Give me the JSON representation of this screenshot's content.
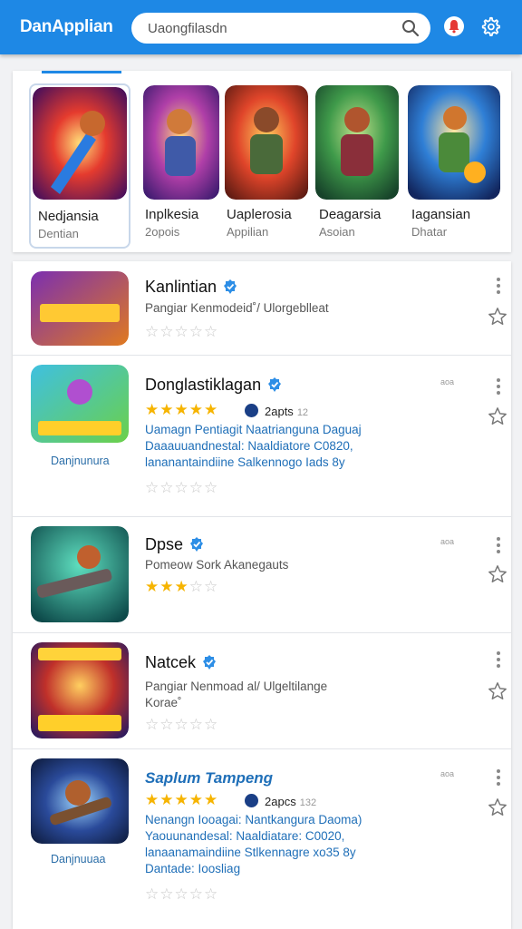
{
  "header": {
    "app_title": "DanApplian",
    "search_placeholder": "Uaongfilasdn",
    "icons": [
      "search-icon",
      "bell-icon",
      "gear-icon"
    ],
    "brand_color": "#1e88e5"
  },
  "featured": [
    {
      "name": "Nedjansia",
      "sub": "Dentian",
      "selected": true
    },
    {
      "name": "Inplkesia",
      "sub": "2opois",
      "selected": false
    },
    {
      "name": "Uaplerosia",
      "sub": "Appilian",
      "selected": false
    },
    {
      "name": "Deagarsia",
      "sub": "Asoian",
      "selected": false
    },
    {
      "name": "Iagansian",
      "sub": "Dhatar",
      "selected": false
    }
  ],
  "list": [
    {
      "title": "Kanlintian",
      "desc": "Pangiar Kenmodeid˚/ Ulorgeblleat",
      "rating": 0
    },
    {
      "title": "Donglastiklagan",
      "rating": 5,
      "badge": "2apts",
      "badge_extra": "12",
      "meta": "aoa",
      "desc_lines": [
        "Uamagn Pentiagit  Naatrianguna Daguaj",
        "Daaauuandnestal:  Naaldiatore C0820,",
        "lananantaindiine  Salkennogo Iads 8y"
      ],
      "caption": "Danjnunura",
      "rating_secondary": 0
    },
    {
      "title": "Dpse",
      "desc": "Pomeow Sork Akanegauts",
      "rating": 3,
      "meta": "aoa"
    },
    {
      "title": "Natcek",
      "desc_lines": [
        "Pangiar Nenmoad al/ Ulgeltilange",
        "Korae˚"
      ],
      "rating": 0
    },
    {
      "title": "Saplum Tampeng",
      "rating": 5,
      "badge": "2apcs",
      "badge_extra": "132",
      "meta": "aoa",
      "desc_lines": [
        "Nenangn Iooagai:  Nantkangura Daoma)",
        "Yaouunandesal:  Naaldiatare: C0020,",
        "lanaanamaindiine  Stlkennagre xo35 8y",
        "Dantade: Ioosliag"
      ],
      "caption": "Danjnuuaa",
      "rating_secondary": 0
    }
  ]
}
